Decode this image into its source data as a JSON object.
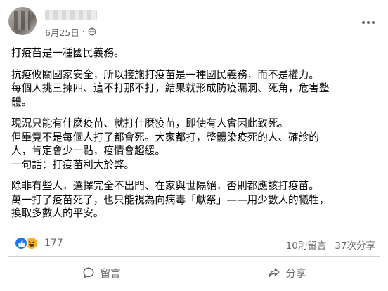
{
  "post": {
    "author_name": "",
    "date": "6月25日",
    "separator": "·",
    "paragraphs": [
      [
        "打疫苗是一種國民義務。"
      ],
      [
        "抗疫攸關國家安全，所以接施打疫苗是一種國民義務，而不是權力。",
        "每個人挑三揀四、這不打那不打，結果就形成防疫漏洞、死角，危害整",
        "體。"
      ],
      [
        "現況只能有什麼疫苗、就打什麼疫苗，即使有人會因此致死。",
        "但畢竟不是每個人打了都會死。大家都打，整體染疫死的人、確診的",
        "人，肯定會少一點，疫情會趨緩。",
        "一句話：打疫苗利大於弊。"
      ],
      [
        "除非有些人，選擇完全不出門、在家與世隔絕，否則都應該打疫苗。",
        "萬一打了疫苗死了，也只能視為向病毒「獻祭」——用少數人的犧牲，",
        "換取多數人的平安。"
      ]
    ]
  },
  "stats": {
    "reaction_count": "177",
    "comments": "10則留言",
    "shares": "37次分享"
  },
  "actions": {
    "comment_label": "留言",
    "share_label": "分享"
  },
  "icons": {
    "privacy": "globe-icon",
    "more": "more-options-icon",
    "like_reaction": "like-icon",
    "haha_reaction": "haha-icon",
    "comment": "comment-icon",
    "share": "share-icon"
  },
  "colors": {
    "brand_blue": "#1877f2",
    "haha_yellow": "#f7b125",
    "secondary_text": "#65676b"
  }
}
